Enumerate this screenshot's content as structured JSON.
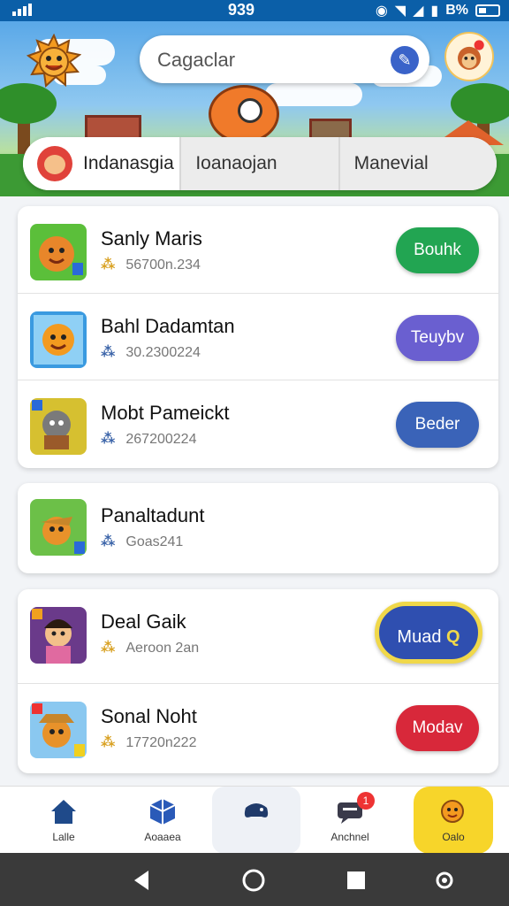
{
  "status_bar": {
    "time": "939",
    "battery_text": "B%"
  },
  "header": {
    "search_placeholder": "Cagaclar",
    "search_button_icon": "pencil-icon",
    "logo_icon": "sun-mascot-icon",
    "avatar_icon": "monkey-avatar-icon"
  },
  "tabs": [
    {
      "label": "Indanasgia",
      "active": true
    },
    {
      "label": "Ioanaojan",
      "active": false
    },
    {
      "label": "Manevial",
      "active": false
    }
  ],
  "group1": [
    {
      "title": "Sanly Maris",
      "meta": "56700n.234",
      "meta_icon": "coins-icon",
      "button": "Bouhk",
      "button_color": "#22a552"
    },
    {
      "title": "Bahl Dadamtan",
      "meta": "30.2300224",
      "meta_icon": "group-icon",
      "button": "Teuybv",
      "button_color": "#6a5fd0"
    },
    {
      "title": "Mobt Pameickt",
      "meta": "267200224",
      "meta_icon": "group-icon",
      "button": "Beder",
      "button_color": "#3a63b8"
    }
  ],
  "group2": [
    {
      "title": "Panaltadunt",
      "meta": "Goas241",
      "meta_icon": "group-icon"
    }
  ],
  "group3": [
    {
      "title": "Deal Gaik",
      "meta": "Aeroon 2an",
      "meta_icon": "coins-icon",
      "button": "Muad",
      "button_color": "#2f4fb0"
    },
    {
      "title": "Sonal Noht",
      "meta": "17720n222",
      "meta_icon": "coins-icon",
      "button": "Modav",
      "button_color": "#d8283a"
    }
  ],
  "bottom_nav": [
    {
      "label": "Lalle",
      "icon": "home-icon"
    },
    {
      "label": "Aoaaea",
      "icon": "cube-icon"
    },
    {
      "label": "",
      "icon": "game-controller-icon"
    },
    {
      "label": "Anchnel",
      "icon": "chat-icon",
      "badge": "1"
    },
    {
      "label": "Oalo",
      "icon": "mascot-icon"
    }
  ],
  "colors": {
    "accent": "#f7d52a",
    "status_bar": "#0b5fa8"
  }
}
